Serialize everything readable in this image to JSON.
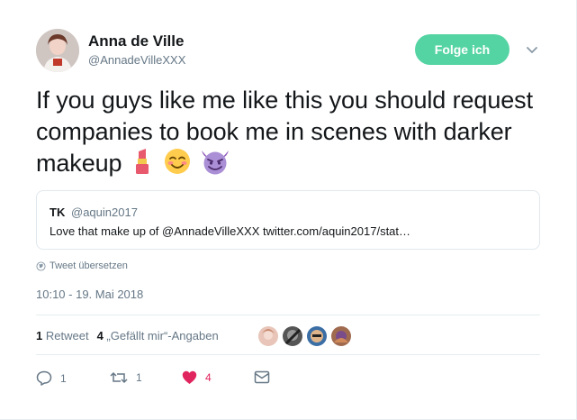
{
  "user": {
    "name": "Anna de Ville",
    "handle": "@AnnadeVilleXXX"
  },
  "follow_button": {
    "label": "Folge ich",
    "color": "#55d4a3"
  },
  "tweet": {
    "text": "If you guys like me like this you should request companies to book me in scenes with darker makeup",
    "emojis": [
      "lipstick-emoji",
      "smiling-blushing-emoji",
      "smiling-imp-emoji"
    ]
  },
  "quote": {
    "name": "TK",
    "handle": "@aquin2017",
    "text": "Love that make up of @AnnadeVilleXXX twitter.com/aquin2017/stat…"
  },
  "translate_label": "Tweet übersetzen",
  "timestamp": "10:10 - 19. Mai 2018",
  "stats": {
    "retweets_count": "1",
    "retweets_label": "Retweet",
    "likes_count": "4",
    "likes_label": "„Gefällt mir“-Angaben"
  },
  "actions": {
    "reply_count": "1",
    "retweet_count": "1",
    "like_count": "4"
  },
  "colors": {
    "like": "#e0245e",
    "secondary_text": "#657786",
    "accent": "#55d4a3"
  }
}
